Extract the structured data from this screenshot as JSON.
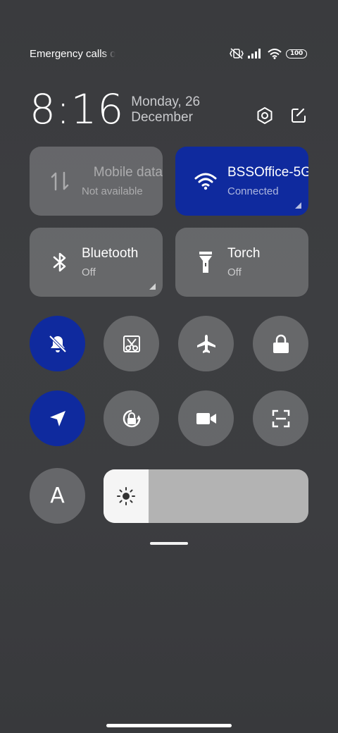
{
  "status_bar": {
    "carrier_text": "Emergency calls only",
    "icons": [
      "mute-vibrate-icon",
      "signal-icon",
      "wifi-icon",
      "battery-icon"
    ],
    "battery_level": "100"
  },
  "header": {
    "time": "8:16",
    "date": "Monday, 26 December",
    "icons": [
      "settings-icon",
      "edit-icon"
    ]
  },
  "tiles": {
    "mobile_data": {
      "title": "Mobile data",
      "subtitle": "Not available",
      "icon": "data-arrows-icon"
    },
    "wifi": {
      "title": "BSSOffice-5G",
      "subtitle": "Connected",
      "icon": "wifi-icon"
    },
    "bluetooth": {
      "title": "Bluetooth",
      "subtitle": "Off",
      "icon": "bluetooth-icon"
    },
    "torch": {
      "title": "Torch",
      "subtitle": "Off",
      "icon": "torch-icon"
    }
  },
  "toggles": {
    "row1": [
      "silent-bell-icon",
      "screenshot-icon",
      "airplane-icon",
      "lock-icon"
    ],
    "row2": [
      "location-icon",
      "rotation-lock-icon",
      "video-icon",
      "scan-icon"
    ]
  },
  "font_button": {
    "label": "A"
  },
  "brightness": {
    "level": 0.22,
    "icon": "sun-icon"
  },
  "colors": {
    "active": "#0f2a9e",
    "inactive_tile": "rgba(255,255,255,0.22)"
  }
}
